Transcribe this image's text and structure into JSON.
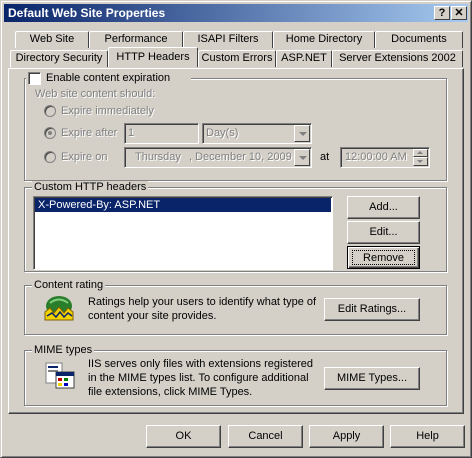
{
  "window": {
    "title": "Default Web Site Properties",
    "help_glyph": "?",
    "close_glyph": "✕"
  },
  "tabs_row1": [
    {
      "label": "Web Site"
    },
    {
      "label": "Performance"
    },
    {
      "label": "ISAPI Filters"
    },
    {
      "label": "Home Directory"
    },
    {
      "label": "Documents"
    }
  ],
  "tabs_row2": [
    {
      "label": "Directory Security"
    },
    {
      "label": "HTTP Headers"
    },
    {
      "label": "Custom Errors"
    },
    {
      "label": "ASP.NET"
    },
    {
      "label": "Server Extensions 2002"
    }
  ],
  "expiration": {
    "checkbox_label": "Enable content expiration",
    "checked": false,
    "should_label": "Web site content should:",
    "expire_immediately": "Expire immediately",
    "expire_after": "Expire after",
    "expire_after_value": "1",
    "expire_after_unit": "Day(s)",
    "expire_on": "Expire on",
    "date_weekday": "Thursday",
    "date_rest": ", December 10, 2009",
    "at_label": "at",
    "time": "12:00:00 AM"
  },
  "custom_headers": {
    "group_label": "Custom HTTP headers",
    "items": [
      "X-Powered-By: ASP.NET"
    ],
    "add_button": "Add...",
    "edit_button": "Edit...",
    "remove_button": "Remove"
  },
  "content_rating": {
    "group_label": "Content rating",
    "description": "Ratings help your users to identify what type of content your site provides.",
    "edit_button": "Edit Ratings..."
  },
  "mime": {
    "group_label": "MIME types",
    "description": "IIS serves only files with extensions registered in the MIME types list. To configure additional file extensions, click MIME Types.",
    "button": "MIME Types..."
  },
  "footer": {
    "ok": "OK",
    "cancel": "Cancel",
    "apply": "Apply",
    "help": "Help"
  }
}
